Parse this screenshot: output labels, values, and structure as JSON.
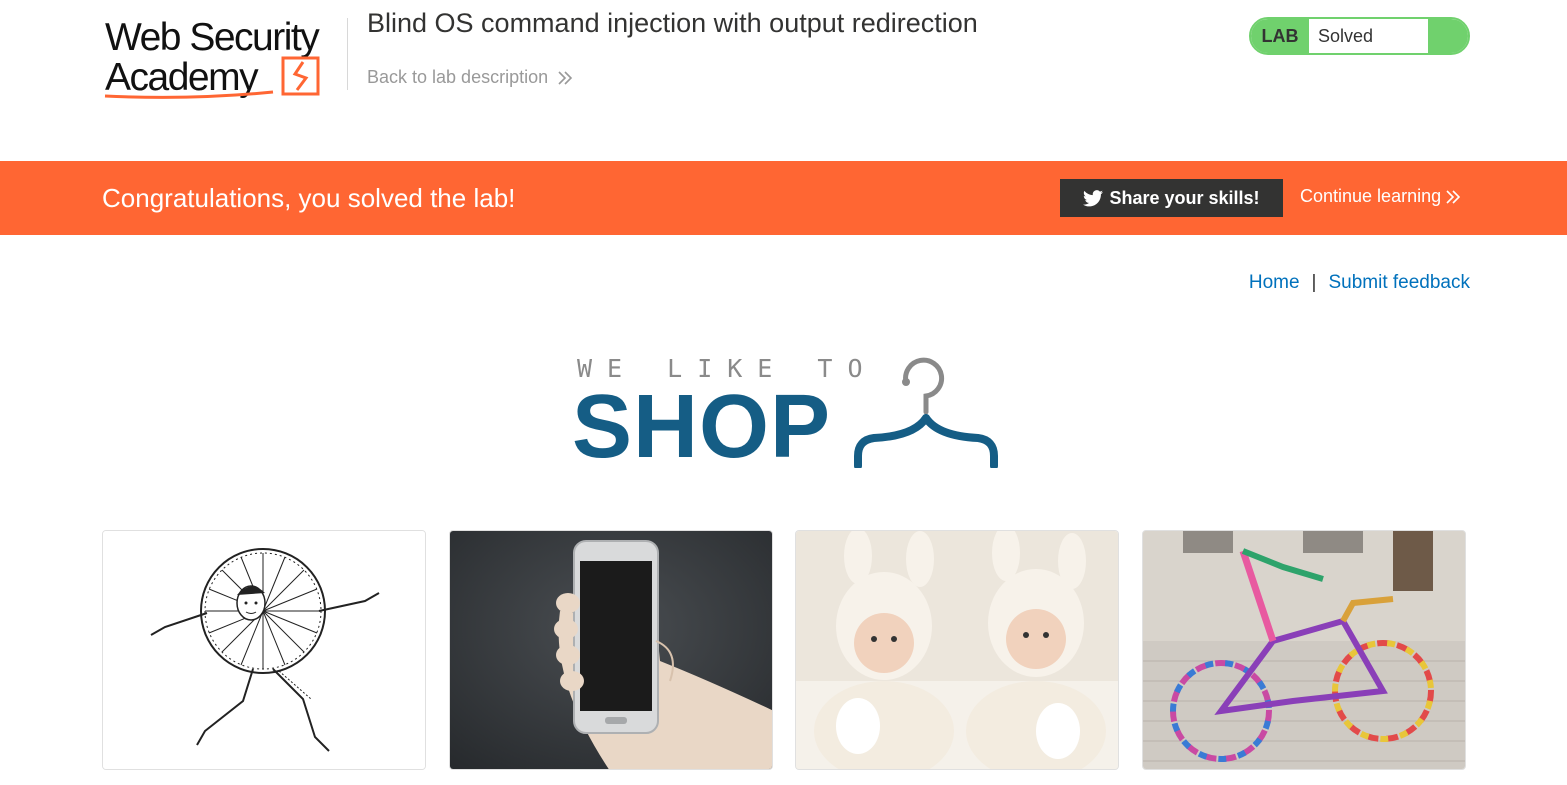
{
  "header": {
    "logo_text_line1": "Web Security",
    "logo_text_line2": "Academy",
    "lab_title": "Blind OS command injection with output redirection",
    "back_link": "Back to lab description",
    "status_tag": "LAB",
    "status_text": "Solved"
  },
  "banner": {
    "message": "Congratulations, you solved the lab!",
    "share_label": "Share your skills!",
    "continue_label": "Continue learning"
  },
  "nav": {
    "home": "Home",
    "separator": "|",
    "feedback": "Submit feedback"
  },
  "shop_logo": {
    "small": "WE LIKE TO",
    "big": "SHOP"
  },
  "products": [
    {
      "image": "cartoon-man-in-wheel"
    },
    {
      "image": "hand-holding-smartphone"
    },
    {
      "image": "twin-babies-in-bunny-hats"
    },
    {
      "image": "yarn-bombed-bicycle"
    }
  ],
  "colors": {
    "accent": "#ff6633",
    "lab_green": "#70d16d",
    "link_blue": "#0071bc",
    "shop_blue": "#155d85",
    "dark": "#333332"
  }
}
